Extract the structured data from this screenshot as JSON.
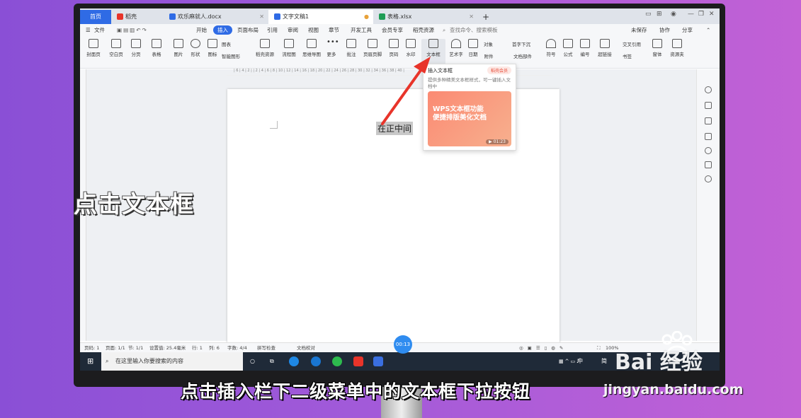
{
  "tabs": [
    {
      "label": "首页"
    },
    {
      "label": "稻壳"
    },
    {
      "label": "欢乐麻就人.docx"
    },
    {
      "label": "文字文稿1"
    },
    {
      "label": "表格.xlsx"
    }
  ],
  "menu": [
    "文件",
    "开始",
    "插入",
    "页面布局",
    "引用",
    "审阅",
    "视图",
    "章节",
    "开发工具",
    "会员专享",
    "稻壳资源"
  ],
  "menu_right": {
    "search": "查找命令、搜索模板",
    "unsaved": "未保存",
    "collab": "协作",
    "share": "分享"
  },
  "ribbon": [
    "封面页",
    "空白页",
    "分页",
    "表格",
    "图片",
    "形状",
    "图标",
    "稻壳资源",
    "流程图",
    "思维导图",
    "更多",
    "批注",
    "页眉页脚",
    "页码",
    "水印",
    "文本框",
    "艺术字",
    "日期",
    "附件",
    "符号",
    "公式",
    "编号",
    "超链接",
    "书签",
    "窗体",
    "资源夹"
  ],
  "ribbon_small": {
    "chart": "图表",
    "smart": "智能图形",
    "object": "对象",
    "dropcap": "首字下沉",
    "docpart": "文档部件",
    "xref": "交叉引用"
  },
  "dropdown": {
    "title": "插入文本框",
    "badge": "稻壳会员",
    "desc": "提供多种精美文本框样式，可一键插入文档中",
    "card_title_1": "WPS文本框功能",
    "card_title_2": "便捷排版美化文档",
    "time": "01:23"
  },
  "document": {
    "selected_text": "在正中间"
  },
  "status": {
    "page": "页码: 1",
    "pages": "页面: 1/1",
    "section": "节: 1/1",
    "setting": "设置值: 25.4毫米",
    "row": "行: 1",
    "col": "列: 6",
    "words": "字数: 4/4",
    "spell": "拼写检查",
    "proof": "文档校对",
    "zoom": "100%"
  },
  "timer": "00:13",
  "taskbar": {
    "search_placeholder": "在这里输入你要搜索的内容",
    "ime": "中",
    "lang": "简"
  },
  "overlay": {
    "left_text": "点击文本框",
    "caption": "点击插入栏下二级菜单中的文本框下拉按钮"
  },
  "watermark": {
    "brand": "Bai 经验",
    "url": "jingyan.baidu.com"
  },
  "colors": {
    "accent": "#2f6be5",
    "arrow": "#e8342a",
    "card": "#fb8a73"
  }
}
